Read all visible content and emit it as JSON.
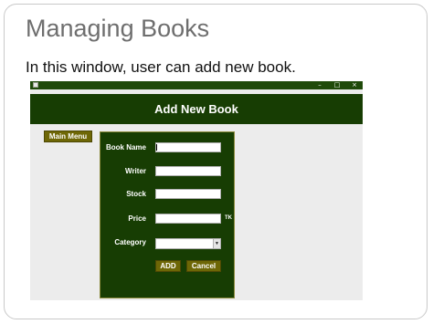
{
  "slide": {
    "title": "Managing Books",
    "body": "In this window, user can add new book."
  },
  "window": {
    "controls": [
      "–",
      "□",
      "×"
    ],
    "header_title": "Add New Book",
    "main_menu_label": "Main Menu",
    "form": {
      "book_name_label": "Book Name",
      "book_name_value": "",
      "writer_label": "Writer",
      "writer_value": "",
      "stock_label": "Stock",
      "stock_value": "",
      "price_label": "Price",
      "price_value": "",
      "price_unit": "TK",
      "category_label": "Category",
      "category_selected": "",
      "add_label": "ADD",
      "cancel_label": "Cancel"
    }
  },
  "colors": {
    "header_bg": "#173d03",
    "button_bg": "#6e6706",
    "titlebar_bg": "#1f4a0a"
  }
}
